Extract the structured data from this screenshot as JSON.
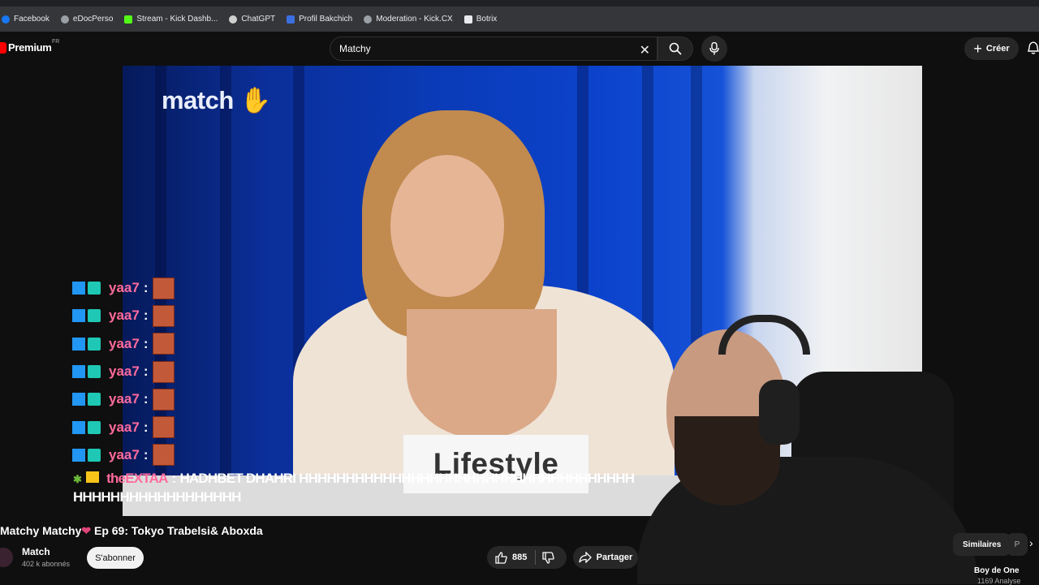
{
  "bookmarks": [
    {
      "label": "Facebook",
      "icon": "facebook-icon",
      "color": "#1877f2"
    },
    {
      "label": "eDocPerso",
      "icon": "globe-icon",
      "color": "#9aa0a6"
    },
    {
      "label": "Stream - Kick Dashb...",
      "icon": "kick-icon",
      "color": "#53fc18"
    },
    {
      "label": "ChatGPT",
      "icon": "chatgpt-icon",
      "color": "#cfcfcf"
    },
    {
      "label": "Profil Bakchich",
      "icon": "bakchich-icon",
      "color": "#3b6fe0"
    },
    {
      "label": "Moderation - Kick.CX",
      "icon": "globe-icon",
      "color": "#9aa0a6"
    },
    {
      "label": "Botrix",
      "icon": "botrix-icon",
      "color": "#e8eaed"
    }
  ],
  "header": {
    "logo_text": "Premium",
    "logo_sup": "FR",
    "search_value": "Matchy",
    "create_label": "Créer"
  },
  "video": {
    "studio_logo": "match",
    "placard": "Lifestyle"
  },
  "chat": {
    "repeat_user": "yaa7",
    "repeat_lines": 7,
    "last_user": "theEXTAA",
    "last_message": "HADHBET DHAHRI HHHHHHHHHHHHHHHHHHHHHHHHHHHHHHHHHHHHHHHHHHHHHHHHHHHHHH"
  },
  "meta": {
    "title_prefix": "Matchy Matchy",
    "title_suffix": "Ep 69: Tokyo Trabelsi& Aboxda",
    "channel": "Match",
    "subscribers": "402 k abonnés",
    "subscribe_label": "S'abonner",
    "likes": "885",
    "share_label": "Partager"
  },
  "sidebar": {
    "chip_similar": "Similaires",
    "chip_p": "P",
    "rec_title": "Boy de One",
    "rec_meta": "1169 Analyse"
  },
  "colors": {
    "accent_red": "#ff0000",
    "chat_name": "#ff6b9d",
    "background": "#0f0f0f"
  }
}
